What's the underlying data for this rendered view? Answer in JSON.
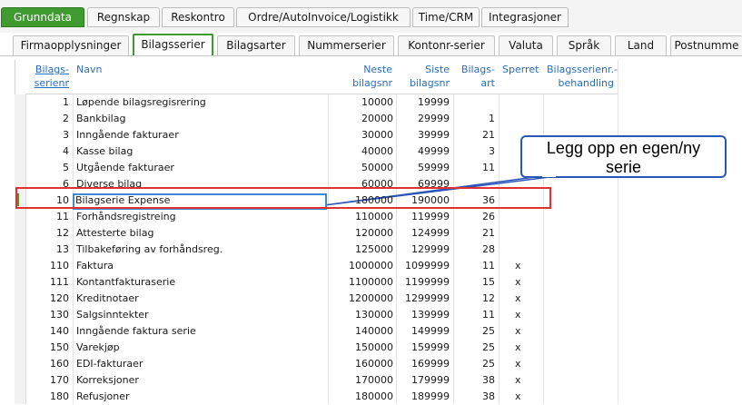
{
  "top_tabs": [
    {
      "label": "Grunndata",
      "active": true
    },
    {
      "label": "Regnskap",
      "active": false
    },
    {
      "label": "Reskontro",
      "active": false
    },
    {
      "label": "Ordre/AutoInvoice/Logistikk",
      "active": false
    },
    {
      "label": "Time/CRM",
      "active": false
    },
    {
      "label": "Integrasjoner",
      "active": false
    }
  ],
  "sub_tabs": [
    {
      "label": "Firmaopplysninger",
      "active": false
    },
    {
      "label": "Bilagsserier",
      "active": true
    },
    {
      "label": "Bilagsarter",
      "active": false
    },
    {
      "label": "Nummerserier",
      "active": false
    },
    {
      "label": "Kontonr-serier",
      "active": false
    },
    {
      "label": "Valuta",
      "active": false
    },
    {
      "label": "Språk",
      "active": false
    },
    {
      "label": "Land",
      "active": false
    },
    {
      "label": "Postnumme",
      "active": false
    }
  ],
  "columns": {
    "serienr_1": "Bilags-",
    "serienr_2": "serienr",
    "navn": "Navn",
    "neste_1": "Neste",
    "neste_2": "bilagsnr",
    "siste_1": "Siste",
    "siste_2": "bilagsnr",
    "art_1": "Bilags-",
    "art_2": "art",
    "sperret": "Sperret",
    "beh_1": "Bilagsserienr.-",
    "beh_2": "behandling"
  },
  "rows": [
    {
      "nr": "1",
      "navn": "Løpende bilagsregisrering",
      "neste": "10000",
      "siste": "19999",
      "art": "",
      "sperret": ""
    },
    {
      "nr": "2",
      "navn": "Bankbilag",
      "neste": "20000",
      "siste": "29999",
      "art": "1",
      "sperret": ""
    },
    {
      "nr": "3",
      "navn": "Inngående fakturaer",
      "neste": "30000",
      "siste": "39999",
      "art": "21",
      "sperret": ""
    },
    {
      "nr": "4",
      "navn": "Kasse bilag",
      "neste": "40000",
      "siste": "49999",
      "art": "3",
      "sperret": ""
    },
    {
      "nr": "5",
      "navn": "Utgående fakturaer",
      "neste": "50000",
      "siste": "59999",
      "art": "11",
      "sperret": ""
    },
    {
      "nr": "6",
      "navn": "Diverse bilag",
      "neste": "60000",
      "siste": "69999",
      "art": "",
      "sperret": ""
    },
    {
      "nr": "10",
      "navn": "Bilagserie Expense",
      "neste": "180000",
      "siste": "190000",
      "art": "36",
      "sperret": ""
    },
    {
      "nr": "11",
      "navn": "Forhåndsregistreing",
      "neste": "110000",
      "siste": "119999",
      "art": "26",
      "sperret": ""
    },
    {
      "nr": "12",
      "navn": "Attesterte bilag",
      "neste": "120000",
      "siste": "124999",
      "art": "21",
      "sperret": ""
    },
    {
      "nr": "13",
      "navn": "Tilbakeføring av forhåndsreg.",
      "neste": "125000",
      "siste": "129999",
      "art": "28",
      "sperret": ""
    },
    {
      "nr": "110",
      "navn": "Faktura",
      "neste": "1000000",
      "siste": "1099999",
      "art": "11",
      "sperret": "x"
    },
    {
      "nr": "111",
      "navn": "Kontantfakturaserie",
      "neste": "1100000",
      "siste": "1199999",
      "art": "15",
      "sperret": "x"
    },
    {
      "nr": "120",
      "navn": "Kreditnotaer",
      "neste": "1200000",
      "siste": "1299999",
      "art": "12",
      "sperret": "x"
    },
    {
      "nr": "130",
      "navn": "Salgsinntekter",
      "neste": "130000",
      "siste": "139999",
      "art": "11",
      "sperret": "x"
    },
    {
      "nr": "140",
      "navn": "Inngående faktura serie",
      "neste": "140000",
      "siste": "149999",
      "art": "25",
      "sperret": "x"
    },
    {
      "nr": "150",
      "navn": "Varekjøp",
      "neste": "150000",
      "siste": "159999",
      "art": "25",
      "sperret": "x"
    },
    {
      "nr": "160",
      "navn": "EDI-fakturaer",
      "neste": "160000",
      "siste": "169999",
      "art": "25",
      "sperret": "x"
    },
    {
      "nr": "170",
      "navn": "Korreksjoner",
      "neste": "170000",
      "siste": "179999",
      "art": "38",
      "sperret": "x"
    },
    {
      "nr": "180",
      "navn": "Refusjoner",
      "neste": "180000",
      "siste": "189999",
      "art": "38",
      "sperret": "x"
    }
  ],
  "callout": {
    "line1": "Legg opp en egen/ny",
    "line2": "serie"
  },
  "colors": {
    "accent": "#3f9a2f",
    "header_text": "#2a6ebf",
    "highlight": "#e03030",
    "callout_border": "#2b56b8"
  }
}
